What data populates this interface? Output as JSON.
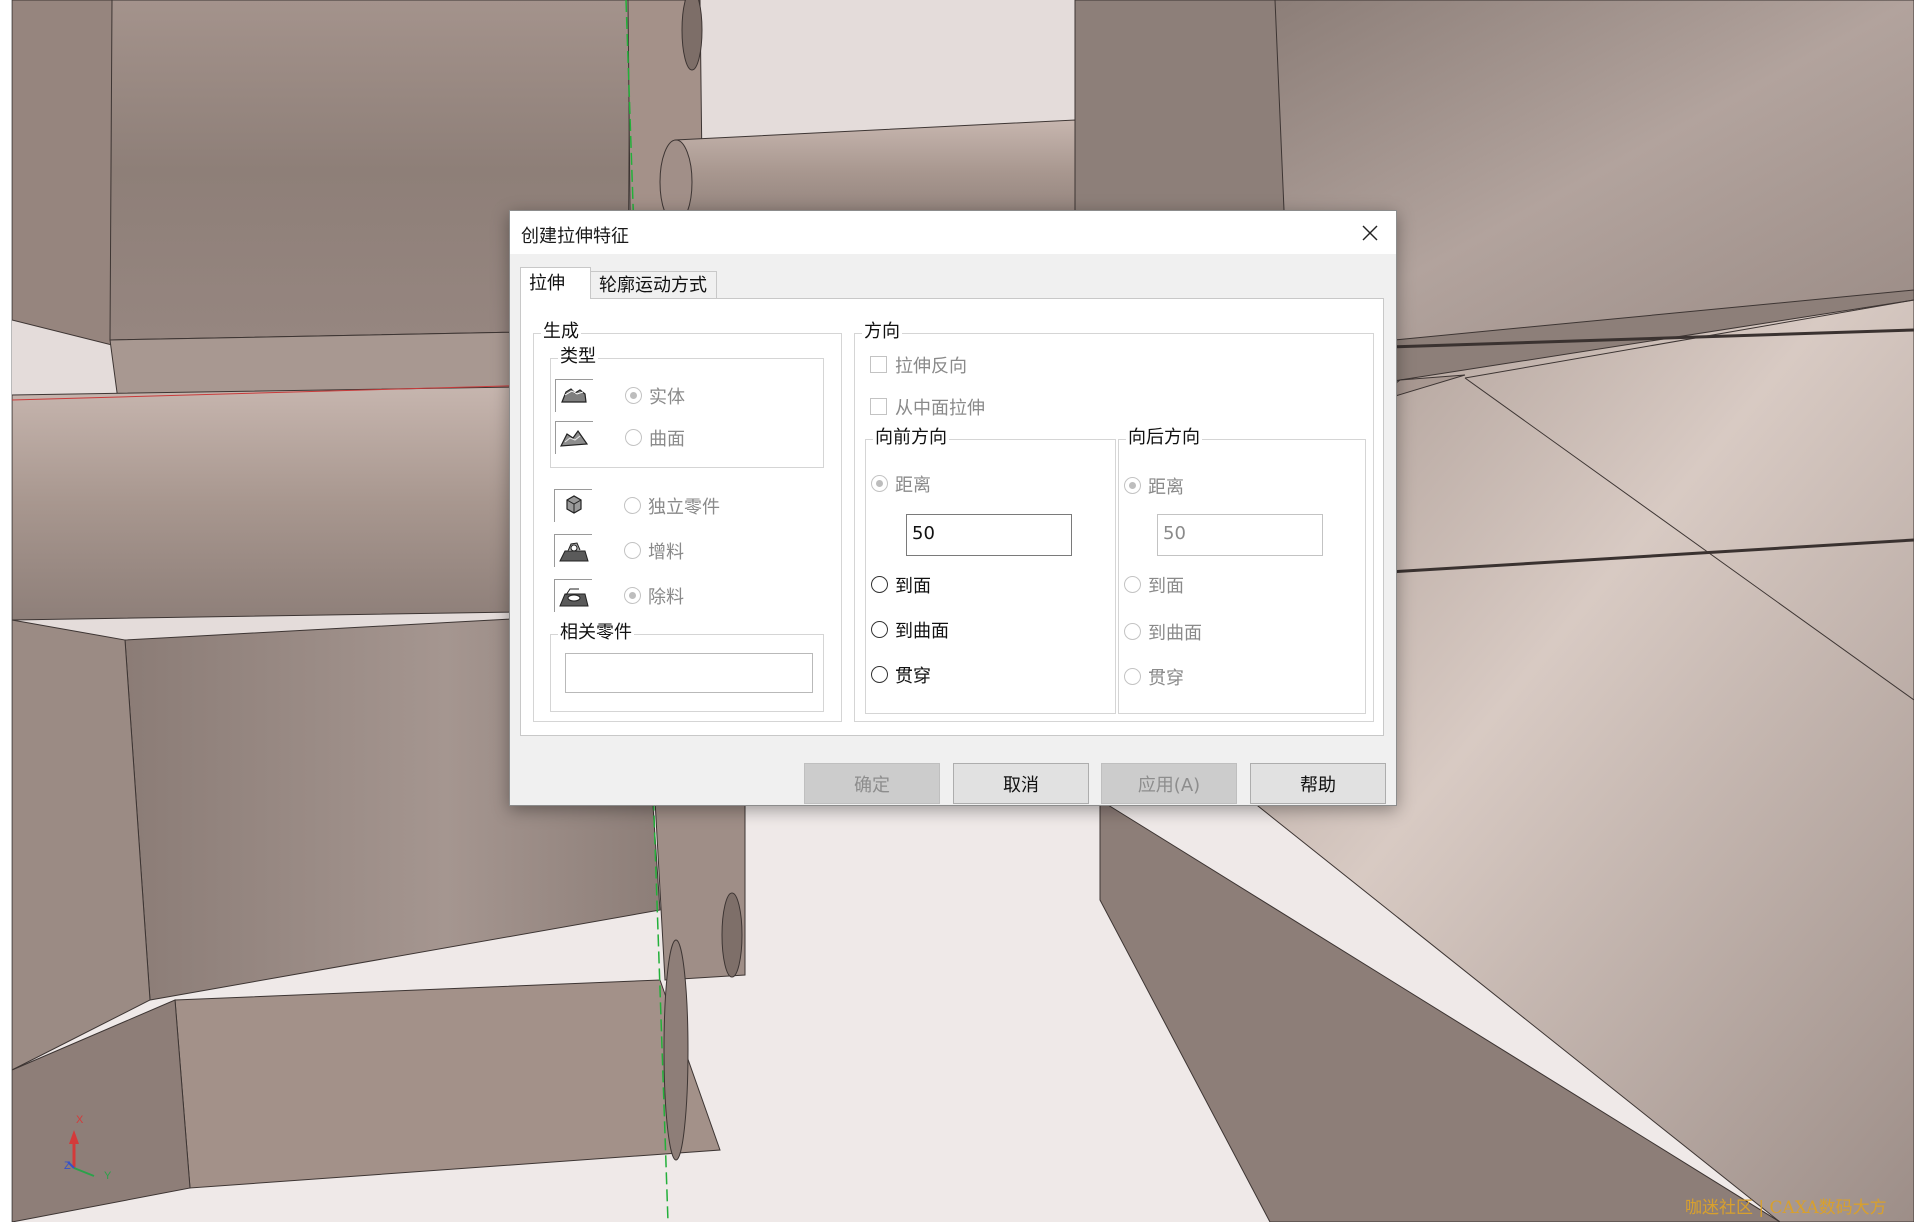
{
  "dialog": {
    "title": "创建拉伸特征",
    "tabs": [
      {
        "label": "拉伸",
        "active": true
      },
      {
        "label": "轮廓运动方式",
        "active": false
      }
    ],
    "generate": {
      "caption": "生成",
      "type_group": {
        "caption": "类型",
        "options": [
          {
            "label": "实体",
            "checked": true,
            "enabled": false,
            "icon": "solid-icon"
          },
          {
            "label": "曲面",
            "checked": false,
            "enabled": false,
            "icon": "surface-icon"
          }
        ]
      },
      "mode_options": [
        {
          "label": "独立零件",
          "checked": false,
          "enabled": false,
          "icon": "part-icon"
        },
        {
          "label": "增料",
          "checked": false,
          "enabled": false,
          "icon": "add-material-icon"
        },
        {
          "label": "除料",
          "checked": true,
          "enabled": false,
          "icon": "remove-material-icon"
        }
      ],
      "related_part": {
        "caption": "相关零件",
        "value": ""
      }
    },
    "direction": {
      "caption": "方向",
      "checkboxes": [
        {
          "label": "拉伸反向",
          "checked": false,
          "enabled": false
        },
        {
          "label": "从中面拉伸",
          "checked": false,
          "enabled": false
        }
      ],
      "forward": {
        "caption": "向前方向",
        "distance_label": "距离",
        "distance_checked": true,
        "distance_value": "50",
        "options": [
          {
            "label": "到面",
            "checked": false
          },
          {
            "label": "到曲面",
            "checked": false
          },
          {
            "label": "贯穿",
            "checked": false
          }
        ],
        "enabled": true
      },
      "backward": {
        "caption": "向后方向",
        "distance_label": "距离",
        "distance_checked": true,
        "distance_value": "50",
        "options": [
          {
            "label": "到面",
            "checked": false
          },
          {
            "label": "到曲面",
            "checked": false
          },
          {
            "label": "贯穿",
            "checked": false
          }
        ],
        "enabled": false
      }
    },
    "buttons": [
      {
        "label": "确定",
        "enabled": false
      },
      {
        "label": "取消",
        "enabled": true
      },
      {
        "label": "应用(A)",
        "enabled": false
      },
      {
        "label": "帮助",
        "enabled": true
      }
    ]
  },
  "viewport": {
    "axis_labels": {
      "x": "X",
      "y": "Y",
      "z": "Z"
    },
    "watermark": "咖迷社区 | CAXA数码大方"
  },
  "colors": {
    "model_surface": "#9a8a83",
    "background": "#efe9e8",
    "dialog": "#f0f0f0",
    "watermark": "#d8a02d"
  }
}
